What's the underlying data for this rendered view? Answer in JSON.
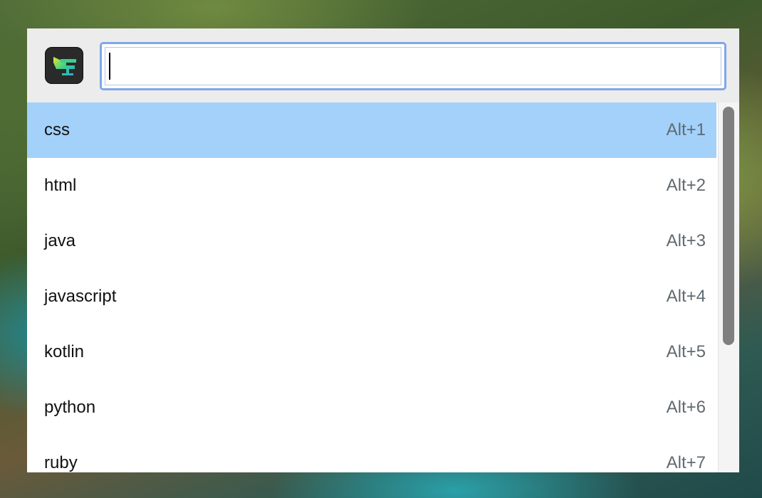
{
  "search": {
    "value": "",
    "placeholder": ""
  },
  "results": [
    {
      "label": "css",
      "shortcut": "Alt+1",
      "selected": true
    },
    {
      "label": "html",
      "shortcut": "Alt+2",
      "selected": false
    },
    {
      "label": "java",
      "shortcut": "Alt+3",
      "selected": false
    },
    {
      "label": "javascript",
      "shortcut": "Alt+4",
      "selected": false
    },
    {
      "label": "kotlin",
      "shortcut": "Alt+5",
      "selected": false
    },
    {
      "label": "python",
      "shortcut": "Alt+6",
      "selected": false
    },
    {
      "label": "ruby",
      "shortcut": "Alt+7",
      "selected": false
    }
  ],
  "scrollbar": {
    "visible_fraction": 0.66
  },
  "colors": {
    "selection": "#a3d1fa",
    "focus_ring": "#7fa7ea",
    "shortcut_text": "#606a70"
  },
  "icons": {
    "app_logo": "snippet-app-icon"
  }
}
